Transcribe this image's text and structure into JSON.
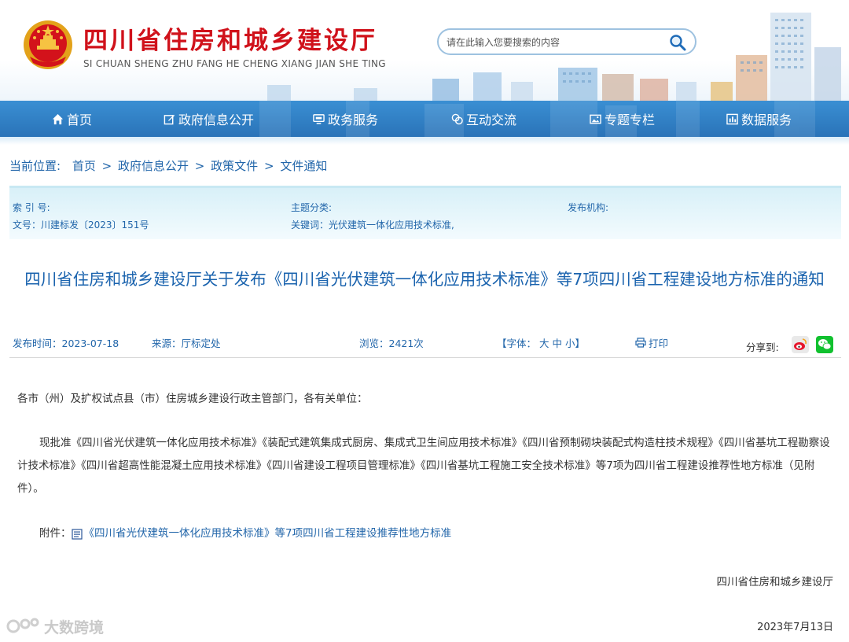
{
  "header": {
    "title": "四川省住房和城乡建设厅",
    "subtitle": "SI CHUAN SHENG ZHU FANG HE CHENG XIANG JIAN SHE TING",
    "search_placeholder": "请在此输入您要搜索的内容"
  },
  "nav": {
    "items": [
      {
        "label": "首页",
        "icon": "home-icon"
      },
      {
        "label": "政府信息公开",
        "icon": "edit-icon"
      },
      {
        "label": "政务服务",
        "icon": "monitor-icon"
      },
      {
        "label": "互动交流",
        "icon": "chat-icon"
      },
      {
        "label": "专题专栏",
        "icon": "image-icon"
      },
      {
        "label": "数据服务",
        "icon": "chart-icon"
      }
    ]
  },
  "breadcrumb": {
    "label": "当前位置:",
    "items": [
      "首页",
      "政府信息公开",
      "政策文件",
      "文件通知"
    ],
    "separator": ">"
  },
  "info": {
    "index_no": "索 引 号:",
    "category": "主题分类:",
    "publisher": "发布机构:",
    "doc_no": "文号：川建标发〔2023〕151号",
    "keywords": "关键词：光伏建筑一体化应用技术标准,"
  },
  "article": {
    "title": "四川省住房和城乡建设厅关于发布《四川省光伏建筑一体化应用技术标准》等7项四川省工程建设地方标准的通知",
    "meta": {
      "publish_time": "发布时间：2023-07-18",
      "source": "来源：厅标定处",
      "views": "浏览：2421次",
      "font_label": "【字体：",
      "font_large": "大",
      "font_medium": "中",
      "font_small": "小",
      "font_end": "】",
      "print": "打印",
      "share": "分享到:"
    },
    "salutation": "各市（州）及扩权试点县（市）住房城乡建设行政主管部门，各有关单位：",
    "body": "现批准《四川省光伏建筑一体化应用技术标准》《装配式建筑集成式厨房、集成式卫生间应用技术标准》《四川省预制砌块装配式构造柱技术规程》《四川省基坑工程勘察设计技术标准》《四川省超高性能混凝土应用技术标准》《四川省建设工程项目管理标准》《四川省基坑工程施工安全技术标准》等7项为四川省工程建设推荐性地方标准（见附件）。",
    "attachment_label": "附件：",
    "attachment_link": "《四川省光伏建筑一体化应用技术标准》等7项四川省工程建设推荐性地方标准",
    "signature": "四川省住房和城乡建设厅",
    "date": "2023年7月13日"
  },
  "watermark": "大数跨境",
  "colors": {
    "title_red": "#d0121b",
    "nav_blue": "#2a73b8",
    "link_blue": "#2266aa"
  }
}
